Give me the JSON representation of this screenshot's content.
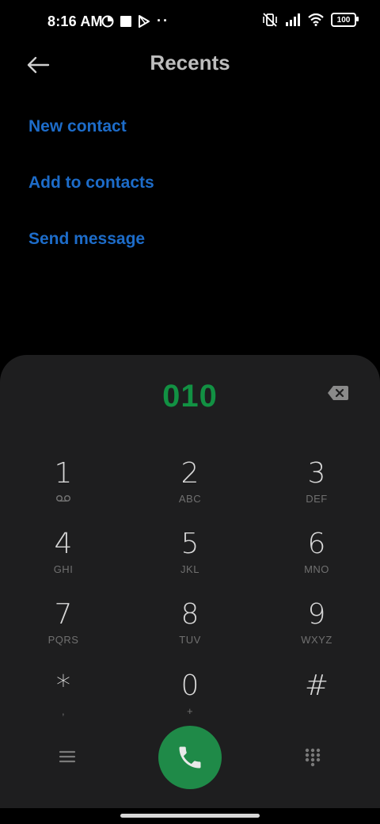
{
  "status_bar": {
    "time": "8:16 AM",
    "battery": "100",
    "more": "··"
  },
  "header": {
    "title": "Recents"
  },
  "actions": [
    "New contact",
    "Add to contacts",
    "Send message"
  ],
  "dialer": {
    "number": "010",
    "keys": [
      {
        "digit": "1",
        "letters": ""
      },
      {
        "digit": "2",
        "letters": "ABC"
      },
      {
        "digit": "3",
        "letters": "DEF"
      },
      {
        "digit": "4",
        "letters": "GHI"
      },
      {
        "digit": "5",
        "letters": "JKL"
      },
      {
        "digit": "6",
        "letters": "MNO"
      },
      {
        "digit": "7",
        "letters": "PQRS"
      },
      {
        "digit": "8",
        "letters": "TUV"
      },
      {
        "digit": "9",
        "letters": "WXYZ"
      },
      {
        "digit": "*",
        "letters": ","
      },
      {
        "digit": "0",
        "letters": "+"
      },
      {
        "digit": "#",
        "letters": ""
      }
    ]
  },
  "colors": {
    "link": "#1d6cc9",
    "number": "#129143",
    "call_button": "#1f8a48",
    "panel": "#1e1e1f"
  }
}
